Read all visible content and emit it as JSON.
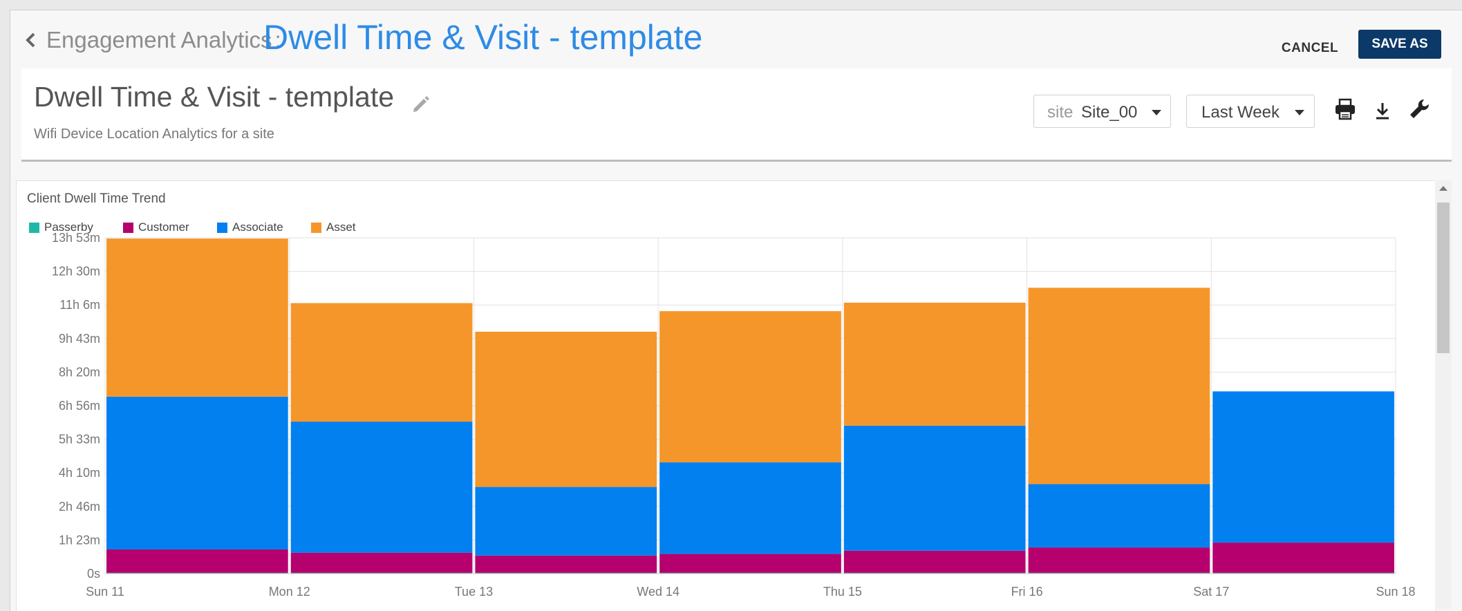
{
  "breadcrumb": {
    "parent": "Engagement Analytics",
    "separator": ":",
    "current": "Dwell Time & Visit - template"
  },
  "actions": {
    "cancel": "CANCEL",
    "save_as": "SAVE AS"
  },
  "report": {
    "title": "Dwell Time & Visit - template",
    "subtitle": "Wifi Device Location Analytics for a site",
    "site_label": "site",
    "site_value": "Site_00",
    "period_value": "Last Week"
  },
  "icons": {
    "back": "chevron-left-icon",
    "edit": "pencil-icon",
    "print": "printer-icon",
    "download": "download-icon",
    "settings": "wrench-icon"
  },
  "colors": {
    "accent": "#2e8be6",
    "primary_button": "#0b3a68"
  },
  "chart_data": {
    "type": "bar",
    "stacked": true,
    "title": "Client Dwell Time Trend",
    "categories": [
      "Sun 11",
      "Mon 12",
      "Tue 13",
      "Wed 14",
      "Thu 15",
      "Fri 16",
      "Sat 17"
    ],
    "x_tick_labels": [
      "Sun 11",
      "Mon 12",
      "Tue 13",
      "Wed 14",
      "Thu 15",
      "Fri 16",
      "Sat 17",
      "Sun 18"
    ],
    "y_tick_labels": [
      "0s",
      "1h 23m",
      "2h 46m",
      "4h 10m",
      "5h 33m",
      "6h 56m",
      "8h 20m",
      "9h 43m",
      "11h 6m",
      "12h 30m",
      "13h 53m"
    ],
    "ylim_minutes": [
      0,
      833
    ],
    "y_unit": "minutes",
    "legend_position": "top-left",
    "grid": true,
    "series": [
      {
        "name": "Passerby",
        "color": "#1fb8a8",
        "values": [
          2,
          2,
          2,
          2,
          2,
          2,
          2
        ]
      },
      {
        "name": "Customer",
        "color": "#b5006e",
        "values": [
          58,
          50,
          43,
          47,
          55,
          63,
          75
        ]
      },
      {
        "name": "Associate",
        "color": "#0280f0",
        "values": [
          379,
          325,
          170,
          227,
          310,
          157,
          375
        ]
      },
      {
        "name": "Asset",
        "color": "#f5962b",
        "values": [
          392,
          294,
          385,
          375,
          305,
          487,
          0
        ]
      }
    ]
  }
}
